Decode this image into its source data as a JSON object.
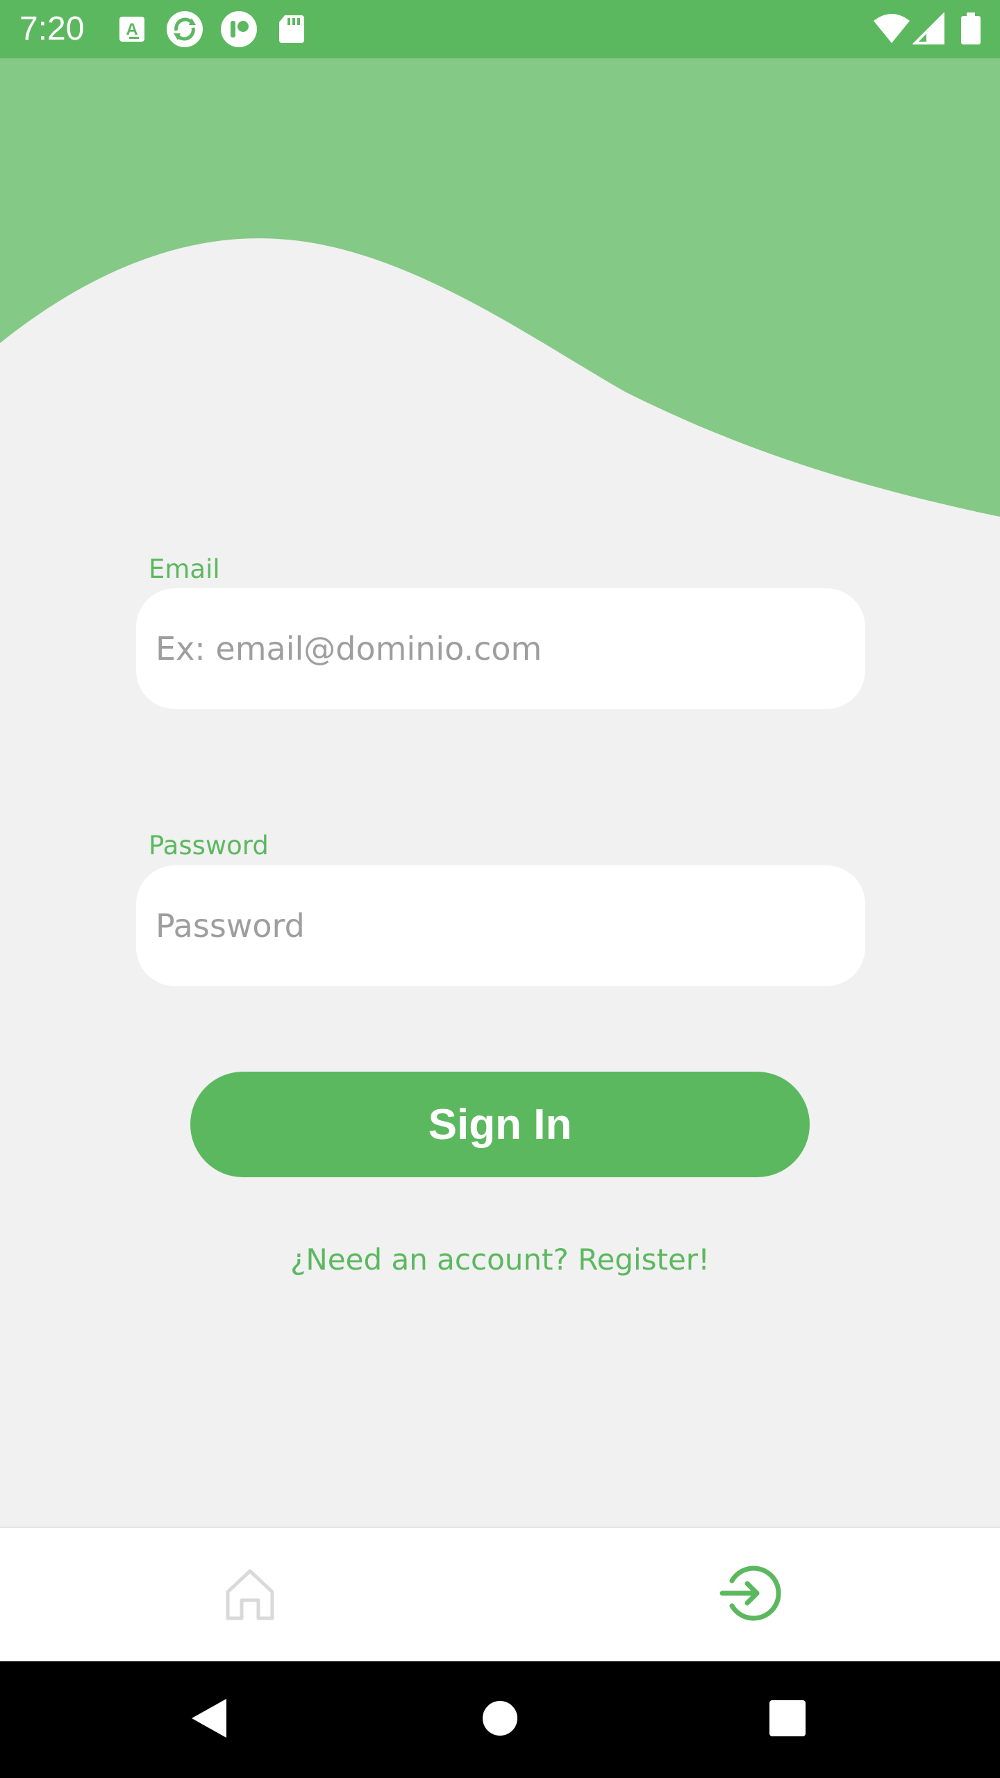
{
  "status_bar": {
    "time": "7:20",
    "left_icons": [
      "font-download-icon",
      "sync-app-icon",
      "app-logo-icon",
      "sd-card-icon"
    ],
    "right_icons": [
      "wifi-icon",
      "signal-icon",
      "battery-icon"
    ]
  },
  "theme": {
    "primary": "#5cb85f",
    "header_wave": "#84c985",
    "background": "#f1f1f1"
  },
  "form": {
    "email": {
      "label": "Email",
      "placeholder": "Ex: email@dominio.com",
      "value": ""
    },
    "password": {
      "label": "Password",
      "placeholder": "Password",
      "value": ""
    },
    "submit_label": "Sign In",
    "register_link": "¿Need an account? Register!"
  },
  "bottom_nav": {
    "items": [
      {
        "icon": "home-icon",
        "active": false
      },
      {
        "icon": "login-icon",
        "active": true
      }
    ]
  },
  "system_nav": {
    "buttons": [
      "back-icon",
      "home-circle-icon",
      "recents-icon"
    ]
  }
}
